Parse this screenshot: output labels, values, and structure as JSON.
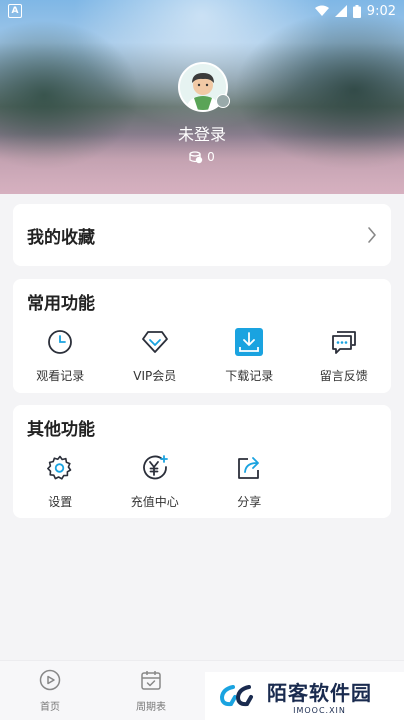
{
  "status_bar": {
    "left_badge": "A",
    "time": "9:02"
  },
  "profile": {
    "username": "未登录",
    "coins": "0"
  },
  "favorites": {
    "title": "我的收藏"
  },
  "common_functions": {
    "title": "常用功能",
    "items": [
      {
        "label": "观看记录",
        "icon": "clock-icon"
      },
      {
        "label": "VIP会员",
        "icon": "diamond-icon"
      },
      {
        "label": "下载记录",
        "icon": "download-icon"
      },
      {
        "label": "留言反馈",
        "icon": "message-icon"
      }
    ]
  },
  "other_functions": {
    "title": "其他功能",
    "items": [
      {
        "label": "设置",
        "icon": "gear-icon"
      },
      {
        "label": "充值中心",
        "icon": "yuan-icon"
      },
      {
        "label": "分享",
        "icon": "share-icon"
      }
    ]
  },
  "bottom_nav": {
    "home": "首页",
    "schedule": "周期表"
  },
  "watermark": {
    "name": "陌客软件园",
    "url": "IMOOC.XIN"
  },
  "colors": {
    "accent": "#1aa3e0",
    "icon_dark": "#2b2f3a"
  }
}
